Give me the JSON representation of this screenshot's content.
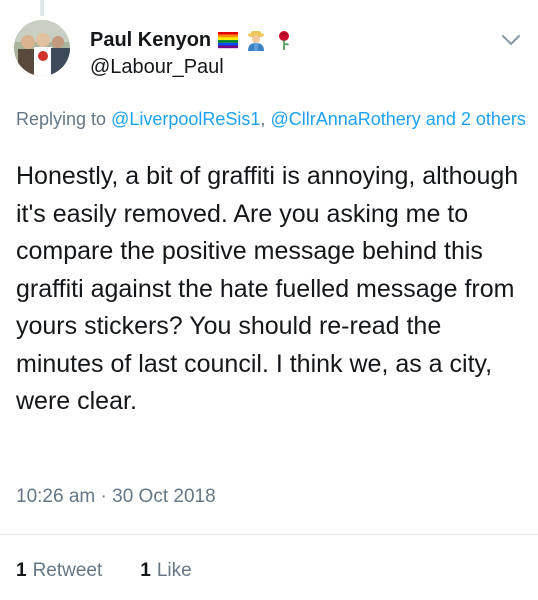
{
  "author": {
    "display_name": "Paul Kenyon",
    "handle": "@Labour_Paul",
    "emoji_icons": [
      "rainbow-flag-icon",
      "man-farmer-icon",
      "red-rose-icon"
    ]
  },
  "reply": {
    "prefix": "Replying to",
    "mention_1": "@LiverpoolReSis1",
    "separator": ",",
    "mention_2": "@CllrAnnaRothery",
    "suffix": "and 2 others"
  },
  "tweet": {
    "text": "Honestly, a bit of graffiti is annoying, although it's easily removed. Are you asking me to compare the positive message behind this graffiti against the hate fuelled message from yours stickers? You should re-read the minutes of last council. I think we, as a city, were clear."
  },
  "meta": {
    "time": "10:26 am",
    "dot": "·",
    "date": "30 Oct 2018"
  },
  "stats": {
    "retweet_count": "1",
    "retweet_label": "Retweet",
    "like_count": "1",
    "like_label": "Like"
  },
  "colors": {
    "link": "#1da1f2",
    "secondary": "#657786",
    "primary_text": "#14171a",
    "divider": "#e1e8ed"
  }
}
